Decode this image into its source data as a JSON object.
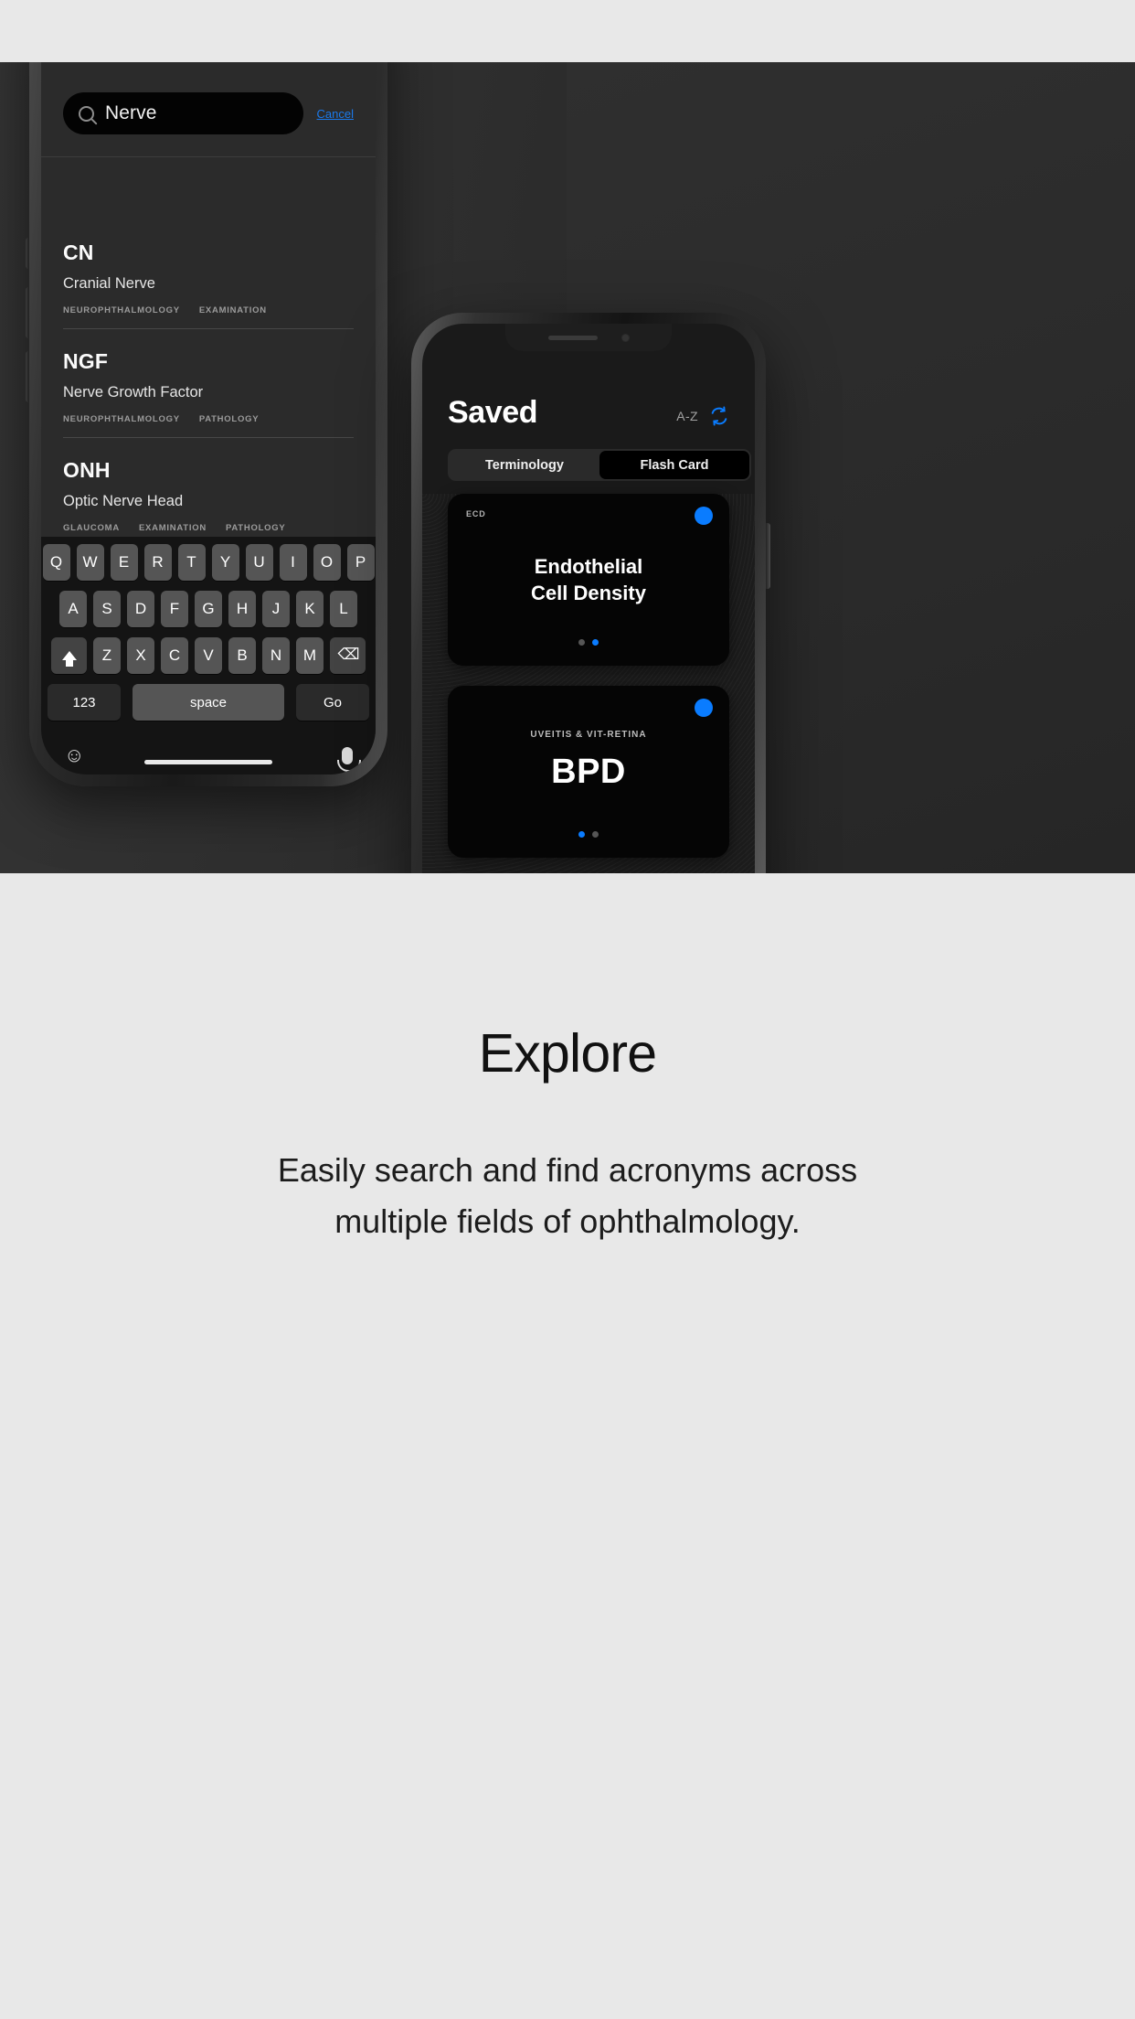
{
  "phone_search": {
    "search_input": {
      "value": "Nerve",
      "placeholder": "Search",
      "icon": "search-icon"
    },
    "cancel_label": "Cancel",
    "results": [
      {
        "abbr": "CN",
        "full": "Cranial Nerve",
        "tags": [
          "NEUROPHTHALMOLOGY",
          "EXAMINATION"
        ]
      },
      {
        "abbr": "NGF",
        "full": "Nerve Growth Factor",
        "tags": [
          "NEUROPHTHALMOLOGY",
          "PATHOLOGY"
        ]
      },
      {
        "abbr": "ONH",
        "full": "Optic Nerve Head",
        "tags": [
          "GLAUCOMA",
          "EXAMINATION",
          "PATHOLOGY"
        ]
      }
    ],
    "keyboard": {
      "row1": [
        "Q",
        "W",
        "E",
        "R",
        "T",
        "Y",
        "U",
        "I",
        "O",
        "P"
      ],
      "row2": [
        "A",
        "S",
        "D",
        "F",
        "G",
        "H",
        "J",
        "K",
        "L"
      ],
      "row3": [
        "Z",
        "X",
        "C",
        "V",
        "B",
        "N",
        "M"
      ],
      "shift_icon": "shift-icon",
      "backspace_icon": "backspace-icon",
      "numbers_key": "123",
      "space_key": "space",
      "go_key": "Go",
      "emoji_icon": "emoji-icon",
      "mic_icon": "microphone-icon"
    }
  },
  "phone_saved": {
    "title": "Saved",
    "sort_label": "A-Z",
    "shuffle_icon": "refresh-icon",
    "tabs": [
      {
        "label": "Terminology",
        "active": false
      },
      {
        "label": "Flash Card",
        "active": true
      }
    ],
    "cards": [
      {
        "abbr": "ECD",
        "category": "",
        "title": "Endothelial\nCell Density",
        "title_line1": "Endothelial",
        "title_line2": "Cell Density",
        "pager": [
          false,
          true
        ],
        "marker_color": "#0a7cff"
      },
      {
        "abbr": "",
        "category": "UVEITIS & VIT-RETINA",
        "title": "BPD",
        "pager": [
          true,
          false
        ],
        "marker_color": "#0a7cff"
      }
    ]
  },
  "bottom": {
    "heading": "Explore",
    "subheading_line1": "Easily search and find acronyms across",
    "subheading_line2": "multiple fields of ophthalmology."
  },
  "colors": {
    "accent_blue": "#0a7cff",
    "link_blue": "#1b7aeb",
    "page_bg": "#e8e8e8",
    "hero_bg": "#2e2e2e"
  }
}
